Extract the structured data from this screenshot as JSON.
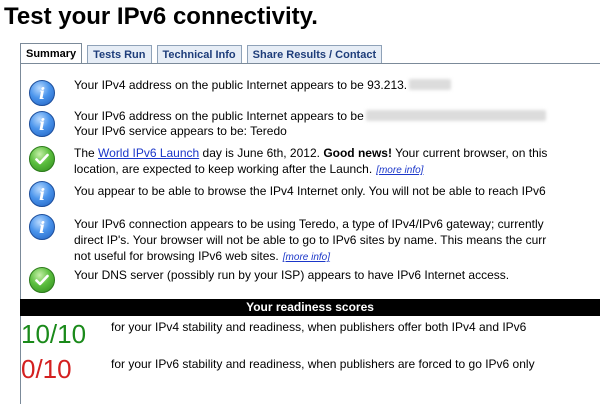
{
  "page": {
    "title": "Test your IPv6 connectivity."
  },
  "tabs": [
    {
      "label": "Summary",
      "active": true
    },
    {
      "label": "Tests Run"
    },
    {
      "label": "Technical Info"
    },
    {
      "label": "Share Results / Contact"
    }
  ],
  "rows": [
    {
      "icon": "info-icon",
      "text": "Your IPv4 address on the public Internet appears to be 93.213."
    },
    {
      "icon": "info-icon",
      "line1": "Your IPv6 address on the public Internet appears to be",
      "line2": "Your IPv6 service appears to be: Teredo"
    },
    {
      "icon": "check-icon",
      "prefix": "The",
      "link": "World IPv6 Launch",
      "mid": "day is June 6th, 2012.",
      "good": "Good news!",
      "rest": "Your current browser, on this",
      "line2": "location, are expected to keep working after the Launch.",
      "more": "[more info]"
    },
    {
      "icon": "info-icon",
      "text": "You appear to be able to browse the IPv4 Internet only. You will not be able to reach IPv6"
    },
    {
      "icon": "info-icon",
      "line1": "Your IPv6 connection appears to be using Teredo, a type of IPv4/IPv6 gateway; currently",
      "line2": "direct IP's. Your browser will not be able to go to IPv6 sites by name. This means the curr",
      "line3": "not useful for browsing IPv6 web sites.",
      "more": "[more info]"
    },
    {
      "icon": "check-icon",
      "text": "Your DNS server (possibly run by your ISP) appears to have IPv6 Internet access."
    }
  ],
  "scores": {
    "header": "Your readiness scores",
    "ipv4": {
      "value": "10/10",
      "color": "#1a8a1a",
      "desc": "for your IPv4 stability and readiness, when publishers offer both IPv4 and IPv6"
    },
    "ipv6": {
      "value": "0/10",
      "color": "#d42020",
      "desc": "for your IPv6 stability and readiness, when publishers are forced to go IPv6 only"
    }
  }
}
